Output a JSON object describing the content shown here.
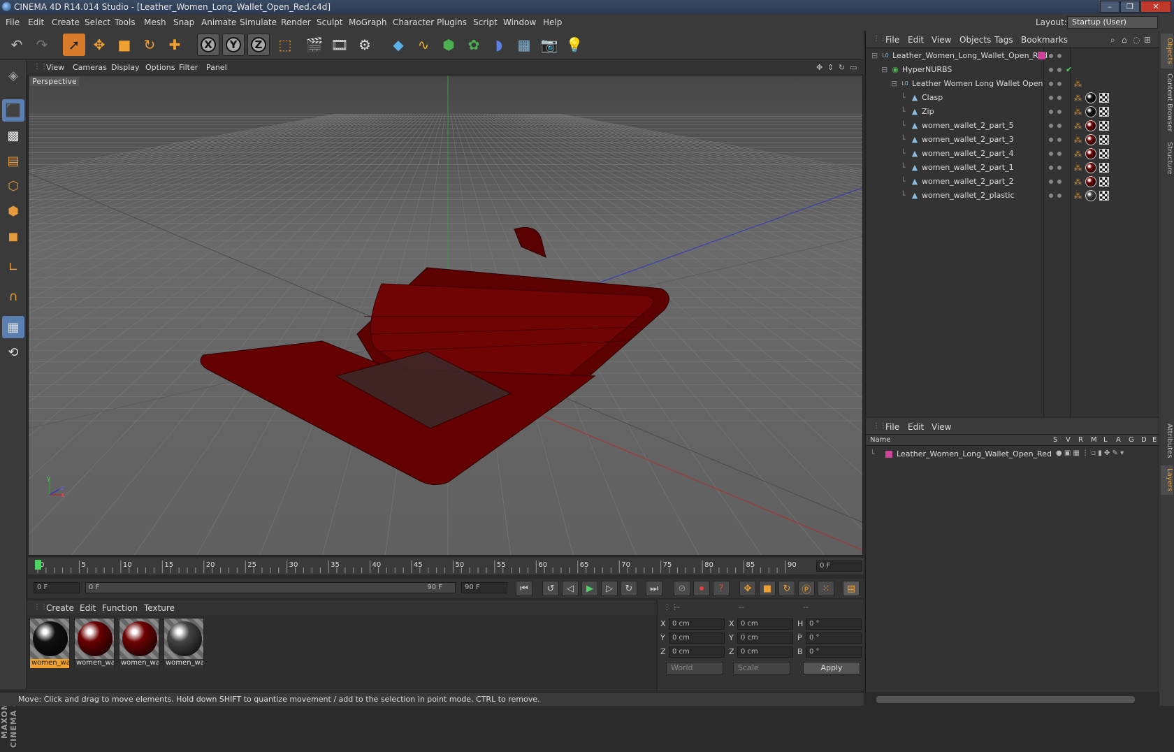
{
  "window": {
    "title": "CINEMA 4D R14.014 Studio - [Leather_Women_Long_Wallet_Open_Red.c4d]",
    "controls": [
      "–",
      "❐",
      "✕"
    ]
  },
  "menubar": {
    "items": [
      "File",
      "Edit",
      "Create",
      "Select",
      "Tools",
      "Mesh",
      "Snap",
      "Animate",
      "Simulate",
      "Render",
      "Sculpt",
      "MoGraph",
      "Character",
      "Plugins",
      "Script",
      "Window",
      "Help"
    ],
    "layout_label": "Layout:",
    "layout_value": "Startup (User)"
  },
  "viewport": {
    "menu": [
      "View",
      "Cameras",
      "Display",
      "Options",
      "Filter",
      "Panel"
    ],
    "label": "Perspective",
    "axis": {
      "y": "y",
      "z": "z",
      "x": "x"
    }
  },
  "timeline": {
    "ticks": [
      "0",
      "5",
      "10",
      "15",
      "20",
      "25",
      "30",
      "35",
      "40",
      "45",
      "50",
      "55",
      "60",
      "65",
      "70",
      "75",
      "80",
      "85",
      "90"
    ],
    "current_frame": "0 F",
    "start_field": "0 F",
    "range_start": "0 F",
    "range_end": "90 F",
    "end_field": "90 F"
  },
  "materials": {
    "menu": [
      "Create",
      "Edit",
      "Function",
      "Texture"
    ],
    "items": [
      {
        "label": "women_wa",
        "color": "#111111",
        "selected": true
      },
      {
        "label": "women_wa",
        "color": "#6b0000",
        "selected": false
      },
      {
        "label": "women_wa",
        "color": "#700303",
        "selected": false
      },
      {
        "label": "women_wa",
        "color": "#444444",
        "selected": false
      }
    ]
  },
  "coords": {
    "headers": [
      "--",
      "--",
      "--"
    ],
    "rows": [
      {
        "a": "X",
        "av": "0 cm",
        "b": "X",
        "bv": "0 cm",
        "c": "H",
        "cv": "0 °"
      },
      {
        "a": "Y",
        "av": "0 cm",
        "b": "Y",
        "bv": "0 cm",
        "c": "P",
        "cv": "0 °"
      },
      {
        "a": "Z",
        "av": "0 cm",
        "b": "Z",
        "bv": "0 cm",
        "c": "B",
        "cv": "0 °"
      }
    ],
    "world": "World",
    "scale": "Scale",
    "apply": "Apply"
  },
  "status": "Move: Click and drag to move elements. Hold down SHIFT to quantize movement / add to the selection in point mode, CTRL to remove.",
  "objects": {
    "menu": [
      "File",
      "Edit",
      "View",
      "Objects",
      "Tags",
      "Bookmarks"
    ],
    "rows": [
      {
        "name": "Leather_Women_Long_Wallet_Open_Red",
        "indent": 0,
        "icon": "null-icon",
        "tag": "layer"
      },
      {
        "name": "HyperNURBS",
        "indent": 1,
        "icon": "hypernurbs-icon",
        "tag": "check"
      },
      {
        "name": "Leather Women Long Wallet Open",
        "indent": 2,
        "icon": "null-icon",
        "tag": "phong"
      },
      {
        "name": "Clasp",
        "indent": 3,
        "icon": "polygon-icon",
        "tag": "mat",
        "mat": "#111111"
      },
      {
        "name": "Zip",
        "indent": 3,
        "icon": "polygon-icon",
        "tag": "mat",
        "mat": "#111111"
      },
      {
        "name": "women_wallet_2_part_5",
        "indent": 3,
        "icon": "polygon-icon",
        "tag": "mat",
        "mat": "#6b0000"
      },
      {
        "name": "women_wallet_2_part_3",
        "indent": 3,
        "icon": "polygon-icon",
        "tag": "mat",
        "mat": "#6b0000"
      },
      {
        "name": "women_wallet_2_part_4",
        "indent": 3,
        "icon": "polygon-icon",
        "tag": "mat",
        "mat": "#6b0000"
      },
      {
        "name": "women_wallet_2_part_1",
        "indent": 3,
        "icon": "polygon-icon",
        "tag": "mat",
        "mat": "#6b0000"
      },
      {
        "name": "women_wallet_2_part_2",
        "indent": 3,
        "icon": "polygon-icon",
        "tag": "mat",
        "mat": "#6b0000"
      },
      {
        "name": "women_wallet_2_plastic",
        "indent": 3,
        "icon": "polygon-icon",
        "tag": "mat",
        "mat": "#444444"
      }
    ]
  },
  "layers": {
    "menu": [
      "File",
      "Edit",
      "View"
    ],
    "headers": [
      "Name",
      "S",
      "V",
      "R",
      "M",
      "L",
      "A",
      "G",
      "D",
      "E"
    ],
    "rows": [
      {
        "name": "Leather_Women_Long_Wallet_Open_Red",
        "color": "#cc4499"
      }
    ]
  },
  "right_tabs": [
    "Objects",
    "Content Browser",
    "Structure",
    "Attributes",
    "Layers"
  ],
  "maxon": "MAXON CINEMA 4D"
}
